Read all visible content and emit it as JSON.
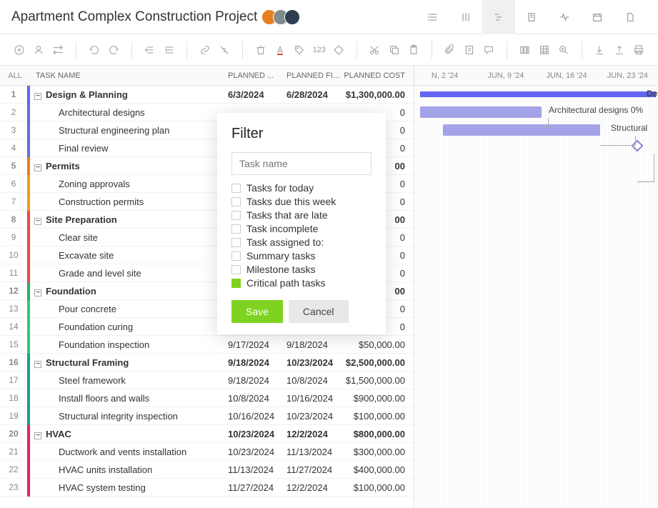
{
  "header": {
    "title": "Apartment Complex Construction Project"
  },
  "columns": {
    "all": "ALL",
    "name": "TASK NAME",
    "start": "PLANNED ...",
    "finish": "PLANNED FI...",
    "cost": "PLANNED COST"
  },
  "rows": [
    {
      "n": "1",
      "name": "Design & Planning",
      "start": "6/3/2024",
      "finish": "6/28/2024",
      "cost": "$1,300,000.00",
      "color": "#6366f1",
      "sum": true
    },
    {
      "n": "2",
      "name": "Architectural designs",
      "start": "",
      "finish": "",
      "cost": "0",
      "color": "#6b6bdc",
      "sum": false
    },
    {
      "n": "3",
      "name": "Structural engineering plan",
      "start": "",
      "finish": "",
      "cost": "0",
      "color": "#6b6bdc",
      "sum": false
    },
    {
      "n": "4",
      "name": "Final review",
      "start": "",
      "finish": "",
      "cost": "0",
      "color": "#6b6bdc",
      "sum": false
    },
    {
      "n": "5",
      "name": "Permits",
      "start": "",
      "finish": "",
      "cost": "00",
      "color": "#e67e22",
      "sum": true
    },
    {
      "n": "6",
      "name": "Zoning approvals",
      "start": "",
      "finish": "",
      "cost": "0",
      "color": "#f39c12",
      "sum": false
    },
    {
      "n": "7",
      "name": "Construction permits",
      "start": "",
      "finish": "",
      "cost": "0",
      "color": "#f39c12",
      "sum": false
    },
    {
      "n": "8",
      "name": "Site Preparation",
      "start": "",
      "finish": "",
      "cost": "00",
      "color": "#e74c3c",
      "sum": true
    },
    {
      "n": "9",
      "name": "Clear site",
      "start": "",
      "finish": "",
      "cost": "0",
      "color": "#e74c3c",
      "sum": false
    },
    {
      "n": "10",
      "name": "Excavate site",
      "start": "",
      "finish": "",
      "cost": "0",
      "color": "#e74c3c",
      "sum": false
    },
    {
      "n": "11",
      "name": "Grade and level site",
      "start": "",
      "finish": "",
      "cost": "0",
      "color": "#e74c3c",
      "sum": false
    },
    {
      "n": "12",
      "name": "Foundation",
      "start": "",
      "finish": "",
      "cost": "00",
      "color": "#27ae60",
      "sum": true
    },
    {
      "n": "13",
      "name": "Pour concrete",
      "start": "",
      "finish": "",
      "cost": "0",
      "color": "#2ecc71",
      "sum": false
    },
    {
      "n": "14",
      "name": "Foundation curing",
      "start": "",
      "finish": "",
      "cost": "0",
      "color": "#2ecc71",
      "sum": false
    },
    {
      "n": "15",
      "name": "Foundation inspection",
      "start": "9/17/2024",
      "finish": "9/18/2024",
      "cost": "$50,000.00",
      "color": "#2ecc71",
      "sum": false
    },
    {
      "n": "16",
      "name": "Structural Framing",
      "start": "9/18/2024",
      "finish": "10/23/2024",
      "cost": "$2,500,000.00",
      "color": "#16a085",
      "sum": true
    },
    {
      "n": "17",
      "name": "Steel framework",
      "start": "9/18/2024",
      "finish": "10/8/2024",
      "cost": "$1,500,000.00",
      "color": "#16a085",
      "sum": false
    },
    {
      "n": "18",
      "name": "Install floors and walls",
      "start": "10/8/2024",
      "finish": "10/16/2024",
      "cost": "$900,000.00",
      "color": "#16a085",
      "sum": false
    },
    {
      "n": "19",
      "name": "Structural integrity inspection",
      "start": "10/16/2024",
      "finish": "10/23/2024",
      "cost": "$100,000.00",
      "color": "#16a085",
      "sum": false
    },
    {
      "n": "20",
      "name": "HVAC",
      "start": "10/23/2024",
      "finish": "12/2/2024",
      "cost": "$800,000.00",
      "color": "#e91e63",
      "sum": true
    },
    {
      "n": "21",
      "name": "Ductwork and vents installation",
      "start": "10/23/2024",
      "finish": "11/13/2024",
      "cost": "$300,000.00",
      "color": "#e91e63",
      "sum": false
    },
    {
      "n": "22",
      "name": "HVAC units installation",
      "start": "11/13/2024",
      "finish": "11/27/2024",
      "cost": "$400,000.00",
      "color": "#e91e63",
      "sum": false
    },
    {
      "n": "23",
      "name": "HVAC system testing",
      "start": "11/27/2024",
      "finish": "12/2/2024",
      "cost": "$100,000.00",
      "color": "#e91e63",
      "sum": false
    }
  ],
  "gantt": {
    "dates": [
      "N, 2 '24",
      "JUN, 9 '24",
      "JUN, 16 '24",
      "JUN, 23 '24"
    ],
    "labels": {
      "design": "De",
      "arch": "Architectural designs  0%",
      "struct": "Structural"
    }
  },
  "filter": {
    "title": "Filter",
    "placeholder": "Task name",
    "opts": [
      {
        "label": "Tasks for today",
        "checked": false
      },
      {
        "label": "Tasks due this week",
        "checked": false
      },
      {
        "label": "Tasks that are late",
        "checked": false
      },
      {
        "label": "Task incomplete",
        "checked": false
      },
      {
        "label": "Task assigned to:",
        "checked": false
      },
      {
        "label": "Summary tasks",
        "checked": false
      },
      {
        "label": "Milestone tasks",
        "checked": false
      },
      {
        "label": "Critical path tasks",
        "checked": true
      }
    ],
    "save": "Save",
    "cancel": "Cancel"
  }
}
